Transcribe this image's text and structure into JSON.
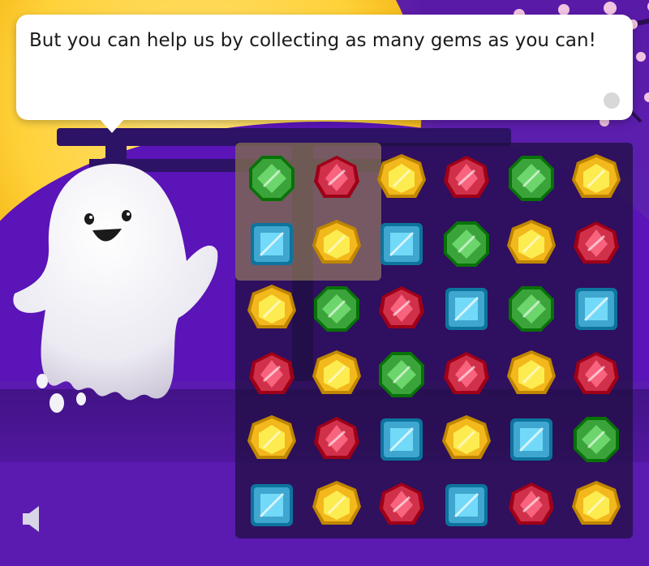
{
  "dialog": {
    "text": "But you can help us by collecting as many gems as you can!"
  },
  "colors": {
    "green": "#3aa33a",
    "red": "#d0304a",
    "yellow": "#f2b81c",
    "blue": "#3fa6cf"
  },
  "board": {
    "rows": [
      [
        "green",
        "red",
        "yellow",
        "red",
        "green",
        "yellow"
      ],
      [
        "blue",
        "yellow",
        "blue",
        "green",
        "yellow",
        "red"
      ],
      [
        "yellow",
        "green",
        "red",
        "blue",
        "green",
        "blue"
      ],
      [
        "red",
        "yellow",
        "green",
        "red",
        "yellow",
        "red"
      ],
      [
        "yellow",
        "red",
        "blue",
        "yellow",
        "blue",
        "green"
      ],
      [
        "blue",
        "yellow",
        "red",
        "blue",
        "red",
        "yellow"
      ]
    ]
  },
  "icons": {
    "sound": "speaker-icon",
    "advance": "next-dot-icon",
    "character": "ghost"
  }
}
